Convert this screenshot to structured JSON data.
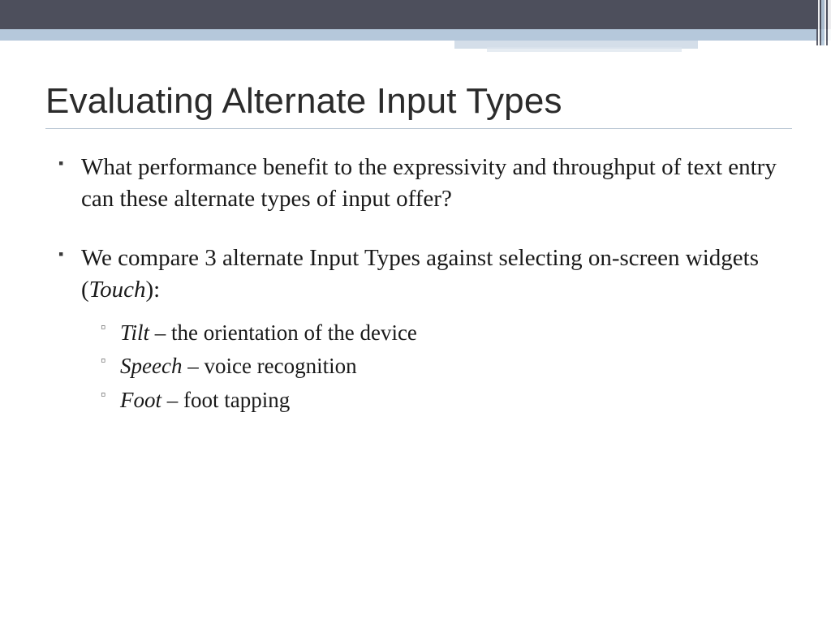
{
  "title": "Evaluating Alternate Input Types",
  "bullets": [
    {
      "text": "What performance benefit to the expressivity and throughput of text entry can these alternate types of input offer?"
    },
    {
      "prefix": "We compare 3 alternate Input Types against selecting on-screen widgets (",
      "emph": "Touch",
      "suffix": "):",
      "sub": [
        {
          "term": "Tilt",
          "desc": " – the orientation of the device"
        },
        {
          "term": "Speech",
          "desc": " – voice recognition"
        },
        {
          "term": "Foot",
          "desc": " – foot tapping"
        }
      ]
    }
  ]
}
